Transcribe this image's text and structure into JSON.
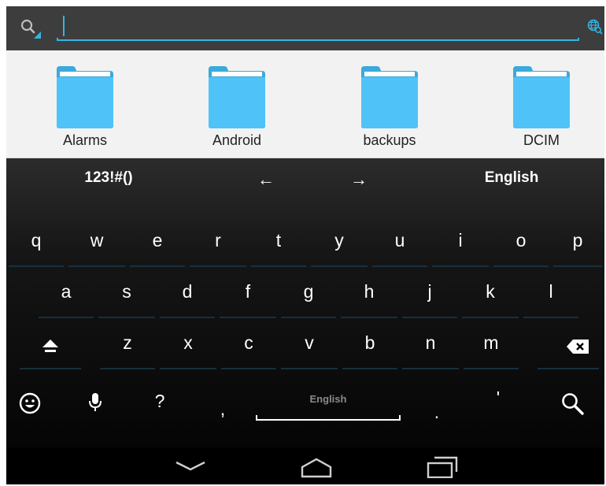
{
  "search": {
    "value": "",
    "placeholder": ""
  },
  "icons": {
    "search": "search-icon",
    "language": "globe-search-icon",
    "folder": "folder-icon"
  },
  "folders": [
    {
      "label": "Alarms"
    },
    {
      "label": "Android"
    },
    {
      "label": "backups"
    },
    {
      "label": "DCIM"
    }
  ],
  "keyboard": {
    "suggestions": {
      "symbols": "123!#()",
      "left": "←",
      "right": "→",
      "language": "English"
    },
    "row1": [
      "q",
      "w",
      "e",
      "r",
      "t",
      "y",
      "u",
      "i",
      "o",
      "p"
    ],
    "row2": [
      "a",
      "s",
      "d",
      "f",
      "g",
      "h",
      "j",
      "k",
      "l"
    ],
    "row3": [
      "z",
      "x",
      "c",
      "v",
      "b",
      "n",
      "m"
    ],
    "bottom": {
      "question": "?",
      "comma": ",",
      "space_label": "English",
      "period": ".",
      "apostrophe": "'"
    }
  },
  "colors": {
    "accent": "#33b5e5",
    "folder": "#4fc3f7",
    "searchbar": "#3d3d3d",
    "files_bg": "#f2f2f2"
  }
}
